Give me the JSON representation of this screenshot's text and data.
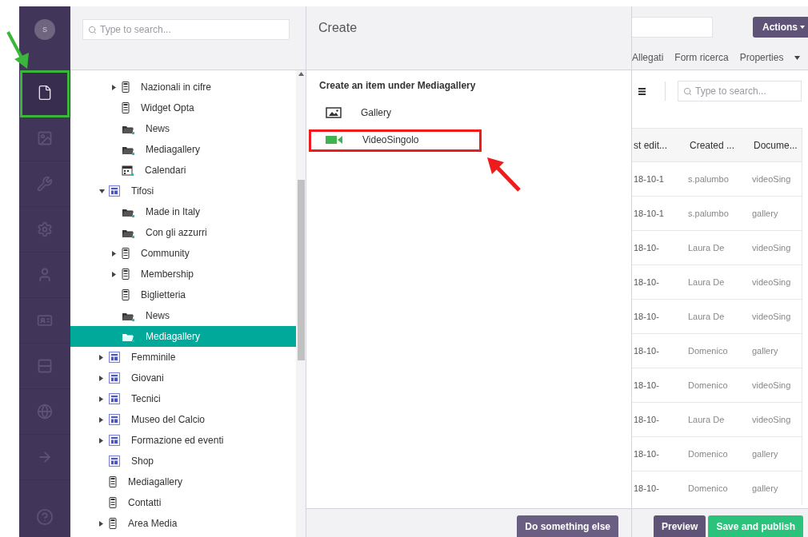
{
  "sidebar": {
    "avatar": "S",
    "sections": [
      {
        "kind": "content",
        "selected": true
      },
      {
        "kind": "media",
        "selected": false
      },
      {
        "kind": "settings",
        "selected": false
      },
      {
        "kind": "gear",
        "selected": false
      },
      {
        "kind": "users",
        "selected": false
      },
      {
        "kind": "members",
        "selected": false
      },
      {
        "kind": "forms",
        "selected": false
      },
      {
        "kind": "translation",
        "selected": false
      },
      {
        "kind": "redirect",
        "selected": false
      }
    ]
  },
  "tree": {
    "search": {
      "placeholder": "Type to search..."
    },
    "partial_items": [
      {
        "label": "Nazionali in cifre",
        "kind": "document",
        "expanded": false,
        "selected": false
      },
      {
        "label": "Widget Opta",
        "kind": "document",
        "selected": false
      },
      {
        "label": "News",
        "kind": "folder",
        "selected": false
      },
      {
        "label": "Mediagallery",
        "kind": "folder",
        "selected": false
      },
      {
        "label": "Calendari",
        "kind": "calendar",
        "selected": false
      }
    ],
    "items": [
      {
        "label": "Tifosi",
        "kind": "section",
        "expanded": true,
        "selected": false,
        "children": [
          {
            "label": "Made in Italy",
            "kind": "folder",
            "selected": false
          },
          {
            "label": "Con gli azzurri",
            "kind": "folder",
            "selected": false
          },
          {
            "label": "Community",
            "kind": "document",
            "expanded": false,
            "selected": false
          },
          {
            "label": "Membership",
            "kind": "document",
            "expanded": false,
            "selected": false
          },
          {
            "label": "Biglietteria",
            "kind": "document",
            "selected": false
          },
          {
            "label": "News",
            "kind": "folder",
            "selected": false
          },
          {
            "label": "Mediagallery",
            "kind": "folder",
            "selected": true
          }
        ]
      },
      {
        "label": "Femminile",
        "kind": "section",
        "expanded": false,
        "selected": false
      },
      {
        "label": "Giovani",
        "kind": "section",
        "expanded": false,
        "selected": false
      },
      {
        "label": "Tecnici",
        "kind": "section",
        "expanded": false,
        "selected": false
      },
      {
        "label": "Museo del Calcio",
        "kind": "section",
        "expanded": false,
        "selected": false
      },
      {
        "label": "Formazione ed eventi",
        "kind": "section",
        "expanded": false,
        "selected": false
      },
      {
        "label": "Shop",
        "kind": "section",
        "selected": false
      },
      {
        "label": "Mediagallery",
        "kind": "document",
        "selected": false
      },
      {
        "label": "Contatti",
        "kind": "document",
        "selected": false
      },
      {
        "label": "Area Media",
        "kind": "document",
        "expanded": false,
        "selected": false
      }
    ]
  },
  "create": {
    "title": "Create",
    "subtitle": "Create an item under Mediagallery",
    "items": [
      {
        "label": "Gallery",
        "kind": "picture"
      },
      {
        "label": "VideoSingolo",
        "kind": "video"
      }
    ],
    "footer_button": "Do something else"
  },
  "editor": {
    "actions_button": "Actions",
    "tabs": [
      {
        "label": "Allegati",
        "selected": false
      },
      {
        "label": "Form ricerca",
        "selected": false
      },
      {
        "label": "Properties",
        "selected": false
      }
    ],
    "list_search": {
      "placeholder": "Type to search..."
    },
    "table": {
      "columns": [
        "st edit...",
        "Created ...",
        "Docume..."
      ],
      "rows": [
        [
          "18-10-1",
          "s.palumbo",
          "videoSing"
        ],
        [
          "18-10-1",
          "s.palumbo",
          "gallery"
        ],
        [
          "18-10-",
          "Laura De",
          "videoSing"
        ],
        [
          "18-10-",
          "Laura De",
          "videoSing"
        ],
        [
          "18-10-",
          "Laura De",
          "videoSing"
        ],
        [
          "18-10-",
          "Domenico",
          "gallery"
        ],
        [
          "18-10-",
          "Domenico",
          "videoSing"
        ],
        [
          "18-10-",
          "Laura De",
          "videoSing"
        ],
        [
          "18-10-",
          "Domenico",
          "gallery"
        ],
        [
          "18-10-",
          "Domenico",
          "gallery"
        ]
      ]
    },
    "buttons": [
      {
        "label": "Preview",
        "kind": "secondary"
      },
      {
        "label": "Save and publish",
        "kind": "primary"
      }
    ]
  }
}
